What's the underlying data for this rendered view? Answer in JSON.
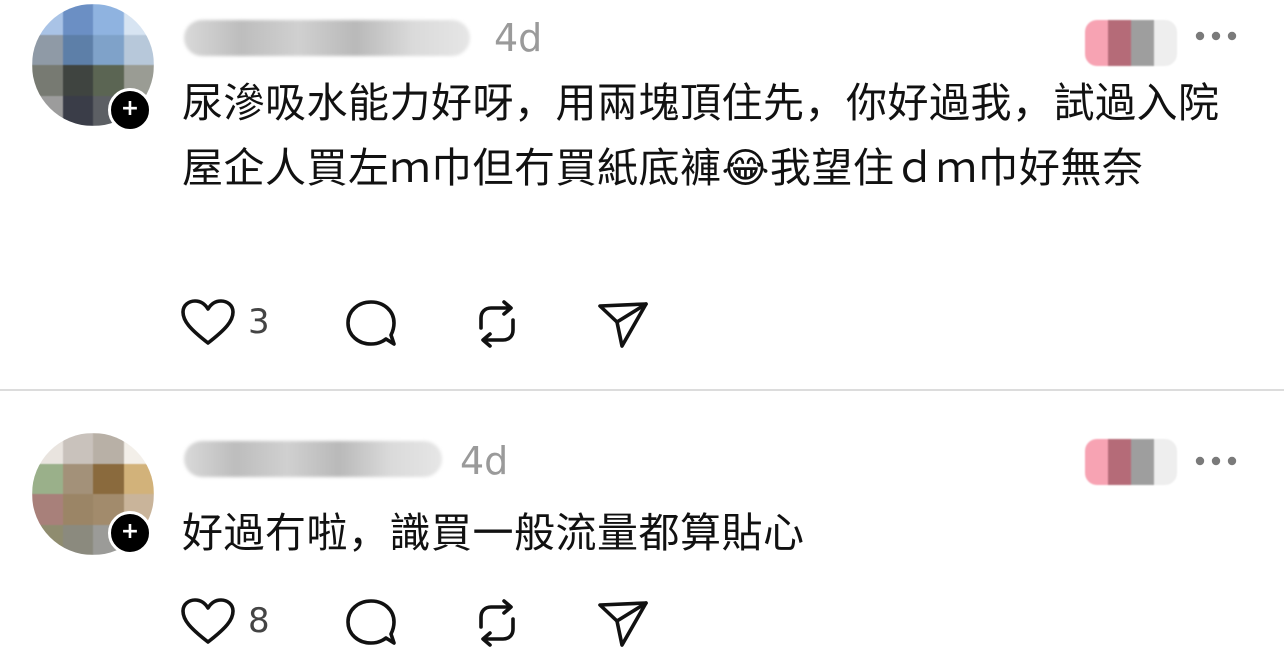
{
  "posts": [
    {
      "timestamp": "4d",
      "body": "尿滲吸水能力好呀，用兩塊頂住先，你好過我，試過入院屋企人買左ｍ巾但冇買紙底褲😂我望住ｄｍ巾好無奈",
      "like_count": "3",
      "follow_badge": "+",
      "icons": [
        "heart-icon",
        "comment-icon",
        "repost-icon",
        "share-icon",
        "more-icon"
      ]
    },
    {
      "timestamp": "4d",
      "body": "好過冇啦，識買一般流量都算貼心",
      "like_count": "8",
      "follow_badge": "+",
      "icons": [
        "heart-icon",
        "comment-icon",
        "repost-icon",
        "share-icon",
        "more-icon"
      ]
    }
  ],
  "colors": {
    "text": "#111111",
    "muted": "#9a9a9a",
    "divider": "#dcdcdc",
    "icon": "#111111"
  }
}
